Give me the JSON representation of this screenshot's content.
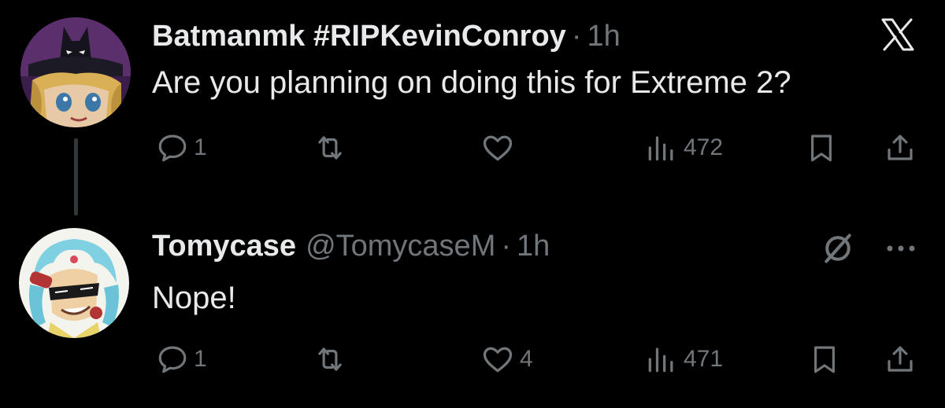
{
  "tweets": [
    {
      "display_name": "Batmanmk #RIPKevinConroy",
      "handle": "",
      "separator": "·",
      "time": "1h",
      "text": "Are you planning on doing this for Extreme 2?",
      "avatar_icon": "batman-anime-avatar",
      "top_right_icon": "x-logo-icon",
      "metrics": {
        "replies": "1",
        "retweets": "",
        "likes": "",
        "views": "472"
      }
    },
    {
      "display_name": "Tomycase",
      "handle": "@TomycaseM",
      "separator": "·",
      "time": "1h",
      "text": "Nope!",
      "avatar_icon": "cartoon-character-avatar",
      "top_right_icon": "grok-icon",
      "more_icon": "more-icon",
      "metrics": {
        "replies": "1",
        "retweets": "",
        "likes": "4",
        "views": "471"
      }
    }
  ],
  "colors": {
    "background": "#000000",
    "primary_text": "#e7e9ea",
    "secondary_text": "#71767b",
    "thread_line": "#333639"
  }
}
